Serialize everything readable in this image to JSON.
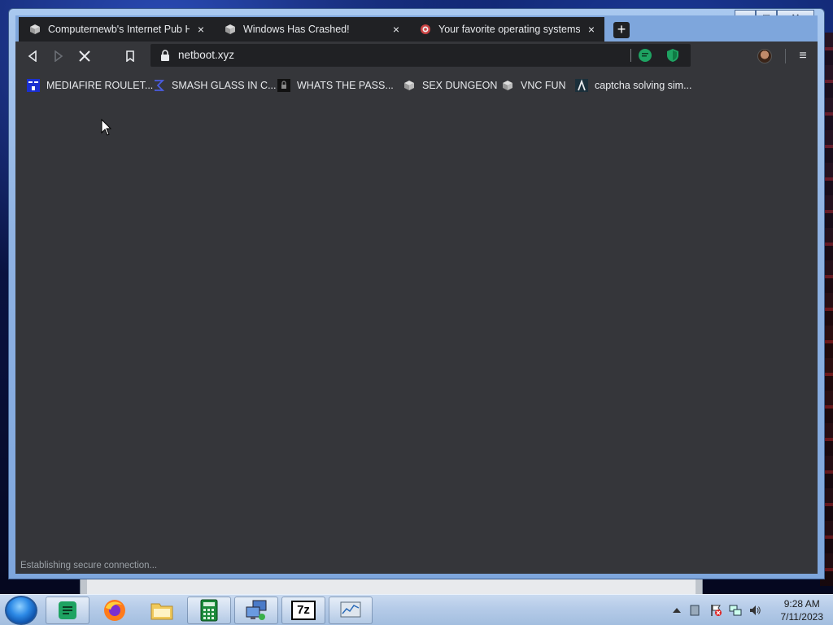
{
  "browser": {
    "tabs": [
      {
        "title": "Computernewb's Internet Pub Hub",
        "favicon": "vm-cube-icon",
        "active": false
      },
      {
        "title": "Windows Has Crashed!",
        "favicon": "vm-cube-icon",
        "active": false
      },
      {
        "title": "Your favorite operating systems in",
        "favicon": "red-ring-icon",
        "active": true
      }
    ],
    "new_tab_label": "+",
    "close_glyph": "×",
    "url": "netboot.xyz",
    "status_text": "Establishing secure connection...",
    "bookmarks": [
      {
        "label": "MEDIAFIRE ROULET...",
        "icon": "mediafire-icon"
      },
      {
        "label": "SMASH GLASS IN C...",
        "icon": "sigma-icon"
      },
      {
        "label": "WHATS THE PASS...",
        "icon": "lock-box-icon"
      },
      {
        "label": "SEX DUNGEON",
        "icon": "vm-cube-icon"
      },
      {
        "label": "VNC FUN",
        "icon": "vm-cube-icon"
      },
      {
        "label": "captcha solving sim...",
        "icon": "lambda-icon"
      }
    ],
    "menu_glyph": "≡"
  },
  "window_controls": {
    "minimize": "▁",
    "maximize": "□",
    "close": "✕"
  },
  "taskbar": {
    "apps": [
      "sheets-icon",
      "firefox-icon",
      "file-explorer-icon",
      "calculator-icon",
      "remote-desktop-icon",
      "7zip-icon",
      "task-manager-icon"
    ],
    "sevenzip_label": "7z",
    "time": "9:28 AM",
    "date": "7/11/2023"
  },
  "colors": {
    "chrome_bg": "#35363a",
    "tab_bg": "#202124",
    "frame": "#7ea6dc",
    "accent_green": "#1ea362"
  }
}
